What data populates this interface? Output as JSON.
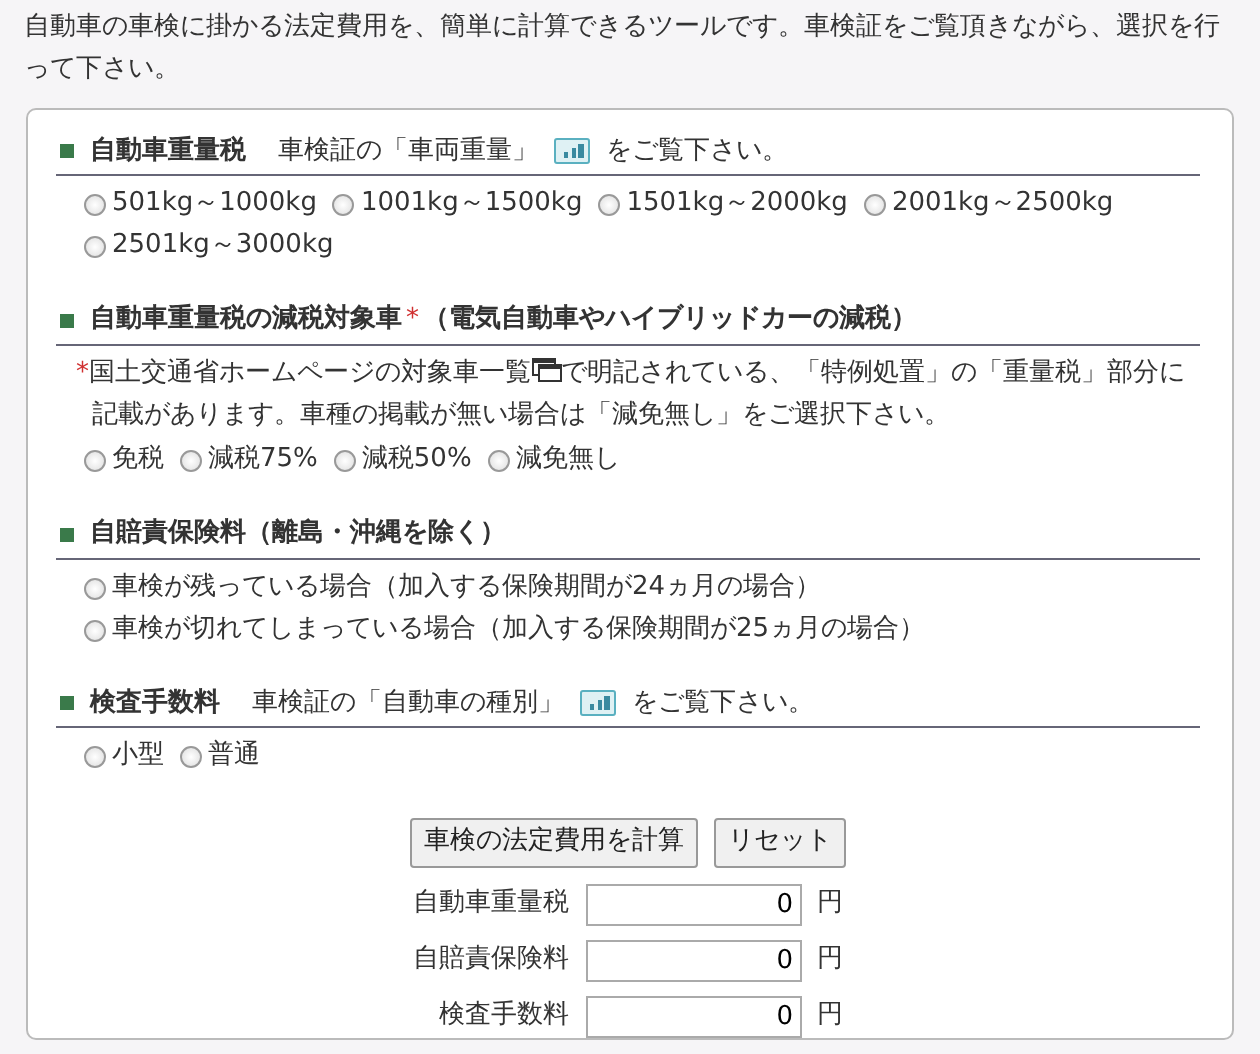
{
  "intro": "自動車の車検に掛かる法定費用を、簡単に計算できるツールです。車検証をご覧頂きながら、選択を行って下さい。",
  "sections": [
    {
      "title": "自動車重量税",
      "hint": "車検証の「車両重量」",
      "hint_end": "をご覧下さい。",
      "options": [
        {
          "label": "501kg～1000kg",
          "selected": false
        },
        {
          "label": "1001kg～1500kg",
          "selected": false
        },
        {
          "label": "1501kg～2000kg",
          "selected": false
        },
        {
          "label": "2001kg～2500kg",
          "selected": false
        },
        {
          "label": "2501kg～3000kg",
          "selected": false
        }
      ]
    },
    {
      "title": "自動車重量税の減税対象車",
      "required_mark": "*",
      "subtitle": "（電気自動車やハイブリッドカーの減税）",
      "note": {
        "mark": "*",
        "link": "国土交通省ホームページの対象車一覧",
        "text": "で明記されている、「特例処置」の「重量税」部分に記載があります。車種の掲載が無い場合は「減免無し」をご選択下さい。"
      },
      "options": [
        {
          "label": "免税",
          "selected": false
        },
        {
          "label": "減税75%",
          "selected": false
        },
        {
          "label": "減税50%",
          "selected": false
        },
        {
          "label": "減免無し",
          "selected": false
        }
      ]
    },
    {
      "title": "自賠責保険料（離島・沖縄を除く）",
      "options": [
        {
          "label": "車検が残っている場合（加入する保険期間が24ヵ月の場合）",
          "selected": false
        },
        {
          "label": "車検が切れてしまっている場合（加入する保険期間が25ヵ月の場合）",
          "selected": false
        }
      ]
    },
    {
      "title": "検査手数料",
      "hint": "車検証の「自動車の種別」",
      "hint_end": "をご覧下さい。",
      "options": [
        {
          "label": "小型",
          "selected": false
        },
        {
          "label": "普通",
          "selected": false
        }
      ]
    }
  ],
  "buttons": [
    "車検の法定費用を計算",
    "リセット"
  ],
  "results": [
    {
      "label": "自動車重量税",
      "value": "0",
      "unit": "円"
    },
    {
      "label": "自賠責保険料",
      "value": "0",
      "unit": "円"
    },
    {
      "label": "検査手数料",
      "value": "0",
      "unit": "円"
    }
  ]
}
